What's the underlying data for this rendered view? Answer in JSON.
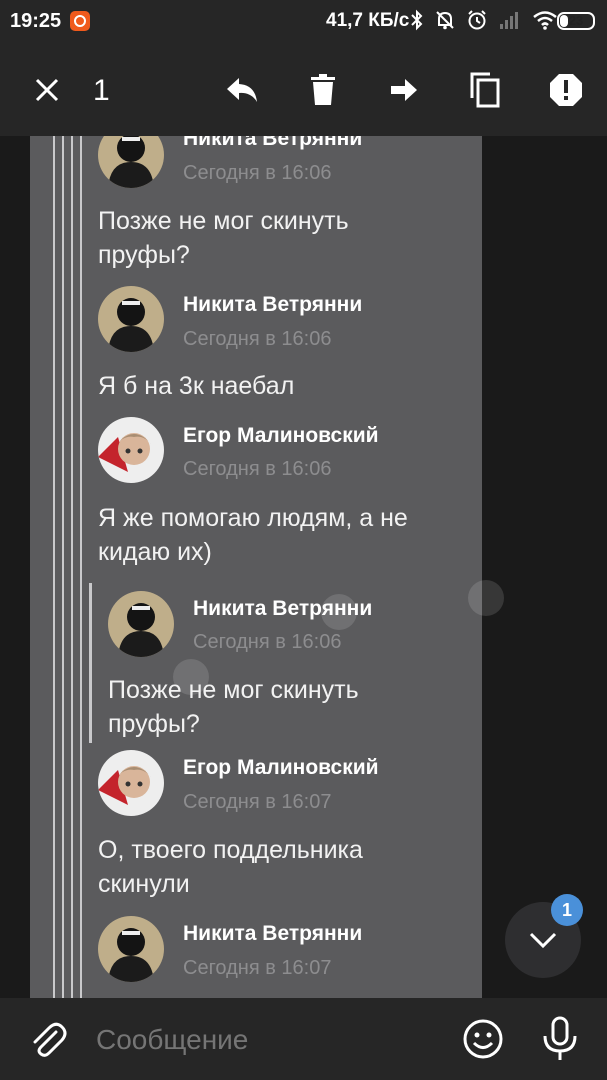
{
  "status_bar": {
    "time": "19:25",
    "speed": "41,7 КБ/с",
    "battery": "23",
    "battery_level": 0.23
  },
  "toolbar": {
    "selected_count": "1",
    "icons": [
      "close-icon",
      "reply-icon",
      "trash-icon",
      "forward-icon",
      "copy-icon",
      "report-icon"
    ]
  },
  "messages": [
    {
      "sender": "Никита Ветрянни",
      "time": "Сегодня в 16:06",
      "text_lines": [
        "Позже не мог скинуть",
        "пруфы?"
      ]
    },
    {
      "sender": "Никита Ветрянни",
      "time": "Сегодня в 16:06",
      "text_lines": [
        "Я б на 3к наебал"
      ]
    },
    {
      "sender": "Егор Малиновский",
      "time": "Сегодня в 16:06",
      "text_lines": [
        "Я же помогаю людям, а не",
        "кидаю их)"
      ]
    },
    {
      "sender": "Никита Ветрянни",
      "time": "Сегодня в 16:06",
      "text_lines": [
        "Позже не мог скинуть",
        "пруфы?"
      ],
      "quoted": true
    },
    {
      "sender": "Егор Малиновский",
      "time": "Сегодня в 16:07",
      "text_lines": [
        "О, твоего поддельника",
        "скинули"
      ]
    },
    {
      "sender": "Никита Ветрянни",
      "time": "Сегодня в 16:07",
      "text_lines": []
    }
  ],
  "scroll_button": {
    "badge": "1"
  },
  "composer": {
    "placeholder": "Сообщение"
  },
  "colors": {
    "background": "#191919",
    "bar": "#262626",
    "selection": "#5b5b5d",
    "badge": "#4a90d9",
    "time_text": "#8d8d8f"
  }
}
